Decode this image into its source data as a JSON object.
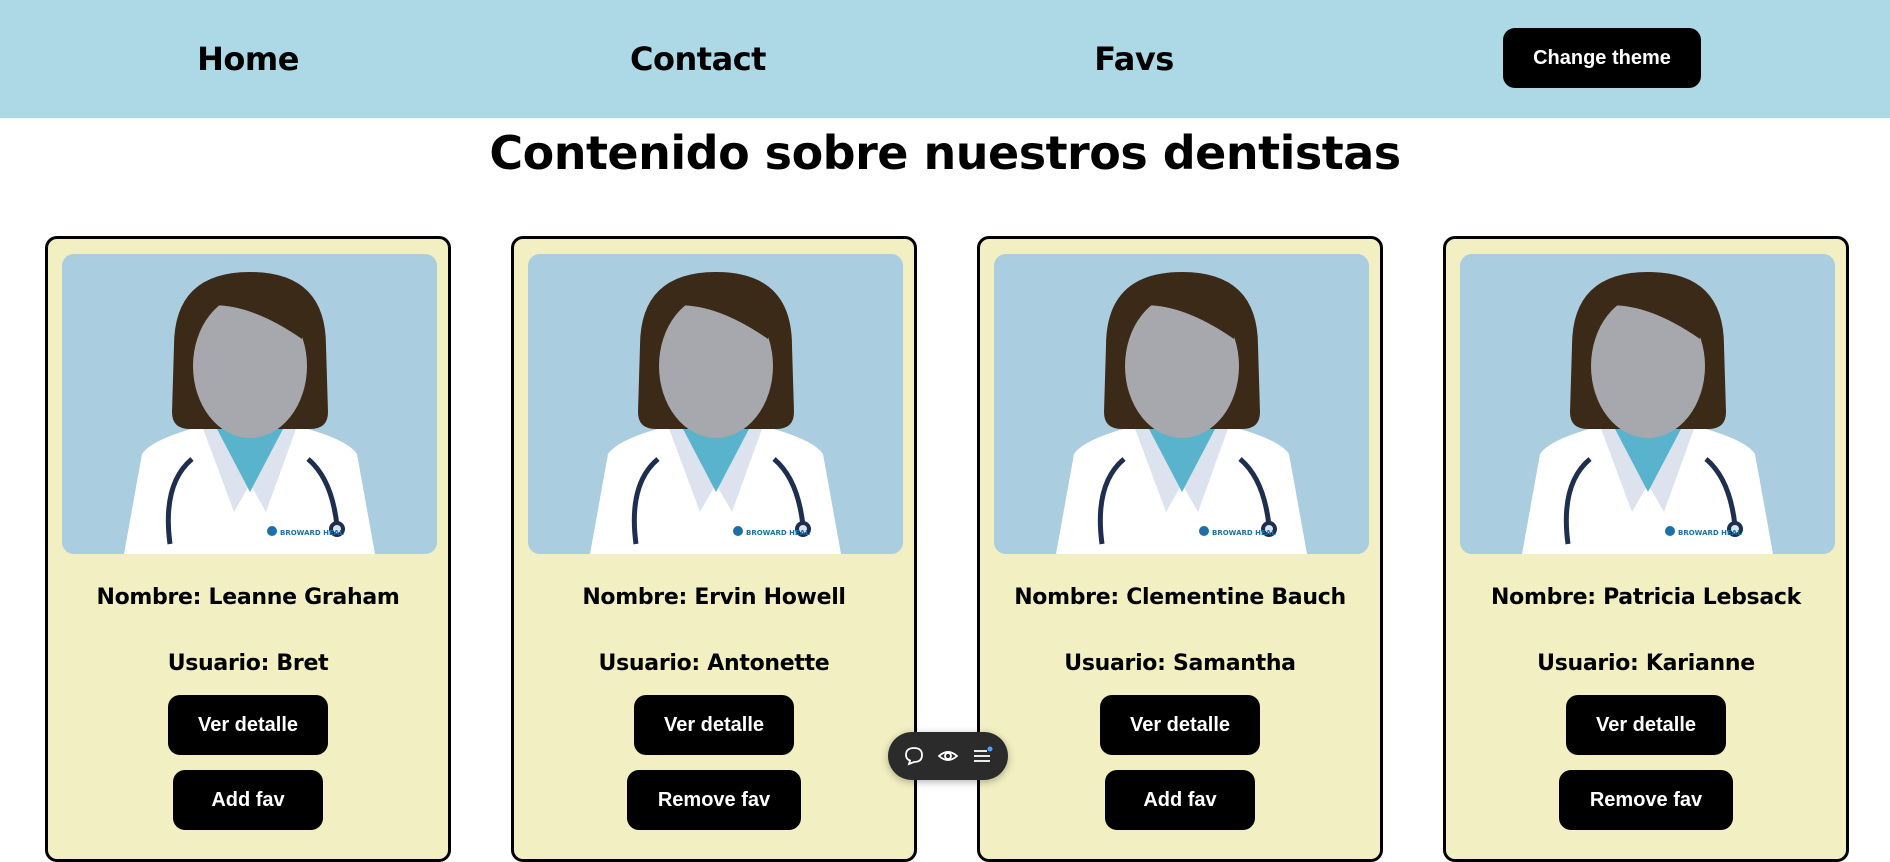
{
  "nav": {
    "home": "Home",
    "contact": "Contact",
    "favs": "Favs",
    "theme_button": "Change theme"
  },
  "page": {
    "title": "Contenido sobre nuestros dentistas"
  },
  "cards": [
    {
      "name": "Nombre: Leanne Graham",
      "user": "Usuario: Bret",
      "detail_label": "Ver detalle",
      "fav_label": "Add fav",
      "badge_text": "BROWARD HEAL"
    },
    {
      "name": "Nombre: Ervin Howell",
      "user": "Usuario: Antonette",
      "detail_label": "Ver detalle",
      "fav_label": "Remove fav",
      "badge_text": "BROWARD HEAL"
    },
    {
      "name": "Nombre: Clementine Bauch",
      "user": "Usuario: Samantha",
      "detail_label": "Ver detalle",
      "fav_label": "Add fav",
      "badge_text": "BROWARD HEAL"
    },
    {
      "name": "Nombre: Patricia Lebsack",
      "user": "Usuario: Karianne",
      "detail_label": "Ver detalle",
      "fav_label": "Remove fav",
      "badge_text": "BROWARD HEAL"
    }
  ],
  "toolbar": {
    "icons": [
      "comment-icon",
      "eye-icon",
      "menu-icon"
    ]
  },
  "colors": {
    "navbar_bg": "#add8e6",
    "card_bg": "#f2efc2",
    "button_bg": "#000000",
    "portrait_bg": "#abcde0"
  }
}
